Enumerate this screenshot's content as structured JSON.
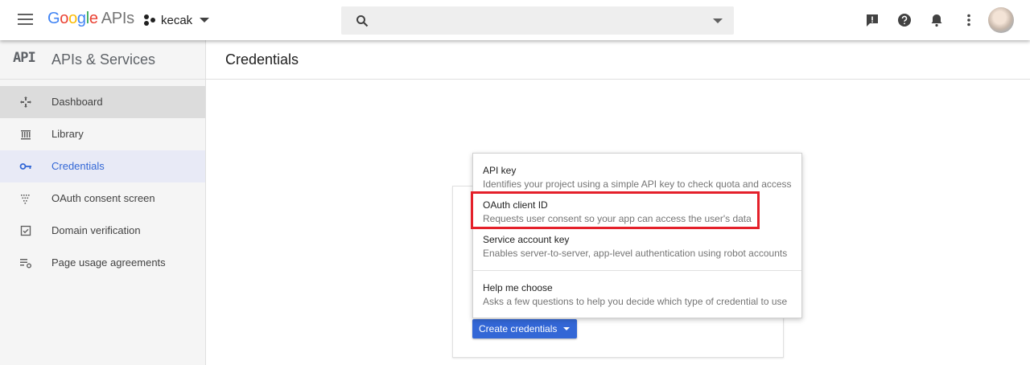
{
  "topbar": {
    "logo_parts": [
      "G",
      "o",
      "o",
      "g",
      "l",
      "e"
    ],
    "logo_suffix": "APIs",
    "project_name": "kecak",
    "search_placeholder": ""
  },
  "sidebar": {
    "badge": "API",
    "title": "APIs & Services",
    "items": [
      {
        "label": "Dashboard",
        "icon": "dashboard-icon"
      },
      {
        "label": "Library",
        "icon": "library-icon"
      },
      {
        "label": "Credentials",
        "icon": "key-icon"
      },
      {
        "label": "OAuth consent screen",
        "icon": "consent-icon"
      },
      {
        "label": "Domain verification",
        "icon": "domain-check-icon"
      },
      {
        "label": "Page usage agreements",
        "icon": "settings-list-icon"
      }
    ]
  },
  "main": {
    "title": "Credentials",
    "create_button": "Create credentials"
  },
  "menu": {
    "items": [
      {
        "title": "API key",
        "description": "Identifies your project using a simple API key to check quota and access"
      },
      {
        "title": "OAuth client ID",
        "description": "Requests user consent so your app can access the user's data"
      },
      {
        "title": "Service account key",
        "description": "Enables server-to-server, app-level authentication using robot accounts"
      },
      {
        "title": "Help me choose",
        "description": "Asks a few questions to help you decide which type of credential to use"
      }
    ]
  },
  "colors": {
    "accent": "#3367d6",
    "highlight": "#e4202a"
  }
}
